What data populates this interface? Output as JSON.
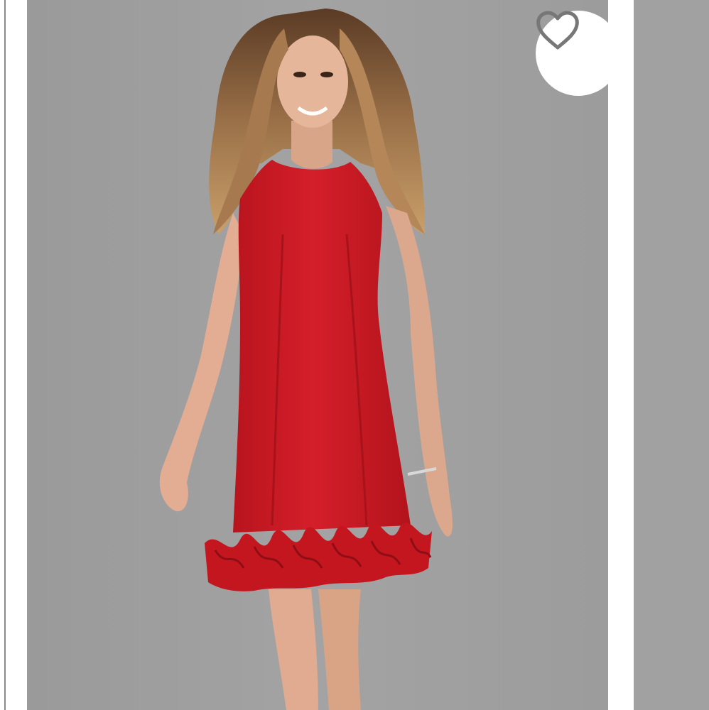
{
  "listing": {
    "photo": {
      "subject": "woman-in-red-sleeveless-dress-with-ruffled-hem",
      "background_color": "#9e9e9e"
    },
    "favorite_button": {
      "icon": "heart-outline-icon",
      "icon_color": "#777777",
      "background_color": "#ffffff"
    },
    "colors": {
      "dress": "#cc1a24",
      "dress_shadow": "#a8121b",
      "skin": "#e3b197",
      "hair": "#8a6343"
    }
  }
}
